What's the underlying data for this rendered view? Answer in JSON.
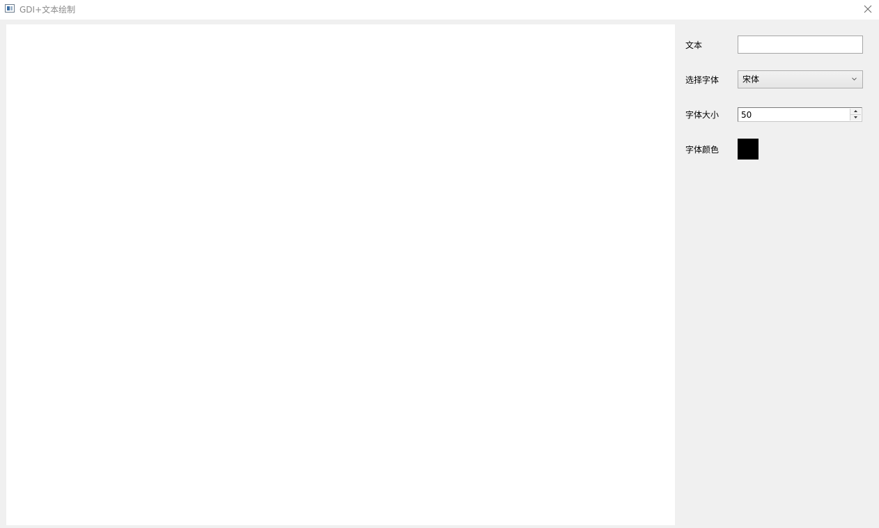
{
  "window": {
    "title": "GDI+文本绘制"
  },
  "panel": {
    "text_label": "文本",
    "text_value": "",
    "font_label": "选择字体",
    "font_value": "宋体",
    "size_label": "字体大小",
    "size_value": "50",
    "color_label": "字体颜色",
    "color_value": "#000000"
  },
  "icons": {
    "app": "app-window-icon",
    "close": "close-icon",
    "dropdown": "chevron-down-icon",
    "spin_up": "spin-up-arrow-icon",
    "spin_down": "spin-down-arrow-icon"
  }
}
